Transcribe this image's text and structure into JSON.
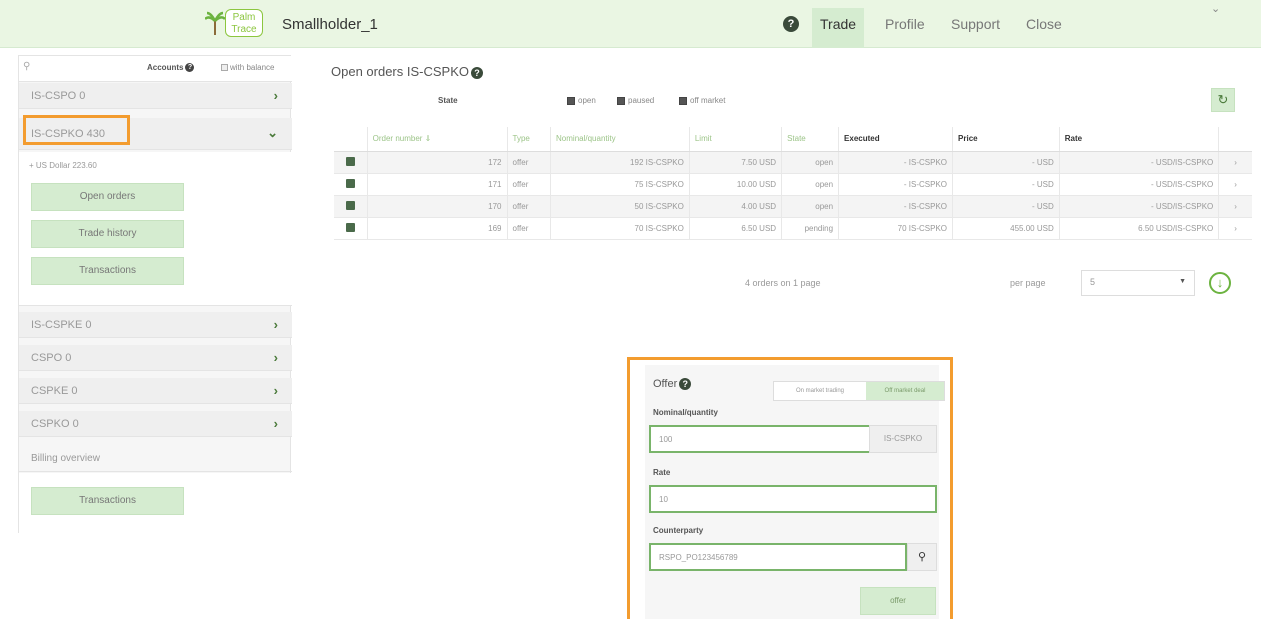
{
  "header": {
    "logo_line1": "Palm",
    "logo_line2": "Trace",
    "app_title": "Smallholder_1",
    "nav": [
      "Trade",
      "Profile",
      "Support",
      "Close"
    ]
  },
  "sidebar": {
    "accounts_label": "Accounts",
    "with_balance_label": "with balance",
    "accounts": [
      {
        "label": "IS-CSPO 0"
      },
      {
        "label": "IS-CSPKO 430"
      },
      {
        "label": "IS-CSPKE 0"
      },
      {
        "label": "CSPO 0"
      },
      {
        "label": "CSPKE 0"
      },
      {
        "label": "CSPKO 0"
      }
    ],
    "balance_line": "+ US Dollar 223.60",
    "buttons": [
      "Open orders",
      "Trade history",
      "Transactions"
    ],
    "billing_label": "Billing overview",
    "billing_button": "Transactions"
  },
  "orders": {
    "title": "Open orders IS-CSPKO",
    "state_label": "State",
    "filters": [
      "open",
      "paused",
      "off market"
    ],
    "columns": [
      "Order number",
      "Type",
      "Nominal/quantity",
      "Limit",
      "State",
      "Executed",
      "Price",
      "Rate"
    ],
    "rows": [
      [
        "172",
        "offer",
        "192 IS-CSPKO",
        "7.50 USD",
        "open",
        "- IS-CSPKO",
        "- USD",
        "- USD/IS-CSPKO"
      ],
      [
        "171",
        "offer",
        "75 IS-CSPKO",
        "10.00 USD",
        "open",
        "- IS-CSPKO",
        "- USD",
        "- USD/IS-CSPKO"
      ],
      [
        "170",
        "offer",
        "50 IS-CSPKO",
        "4.00 USD",
        "open",
        "- IS-CSPKO",
        "- USD",
        "- USD/IS-CSPKO"
      ],
      [
        "169",
        "offer",
        "70 IS-CSPKO",
        "6.50 USD",
        "pending",
        "70 IS-CSPKO",
        "455.00 USD",
        "6.50 USD/IS-CSPKO"
      ]
    ],
    "count_text": "4 orders on 1 page",
    "per_page_label": "per page",
    "per_page_value": "5"
  },
  "offer": {
    "title": "Offer",
    "mode_on": "On market trading",
    "mode_off": "Off market deal",
    "nominal_label": "Nominal/quantity",
    "nominal_value": "100",
    "nominal_unit": "IS-CSPKO",
    "rate_label": "Rate",
    "rate_value": "10",
    "counterparty_label": "Counterparty",
    "counterparty_value": "RSPO_PO123456789",
    "submit_label": "offer"
  },
  "colors": {
    "header_bg": "#eaf6e3",
    "accent_green": "#6cb340",
    "highlight_orange": "#f39c2f"
  }
}
